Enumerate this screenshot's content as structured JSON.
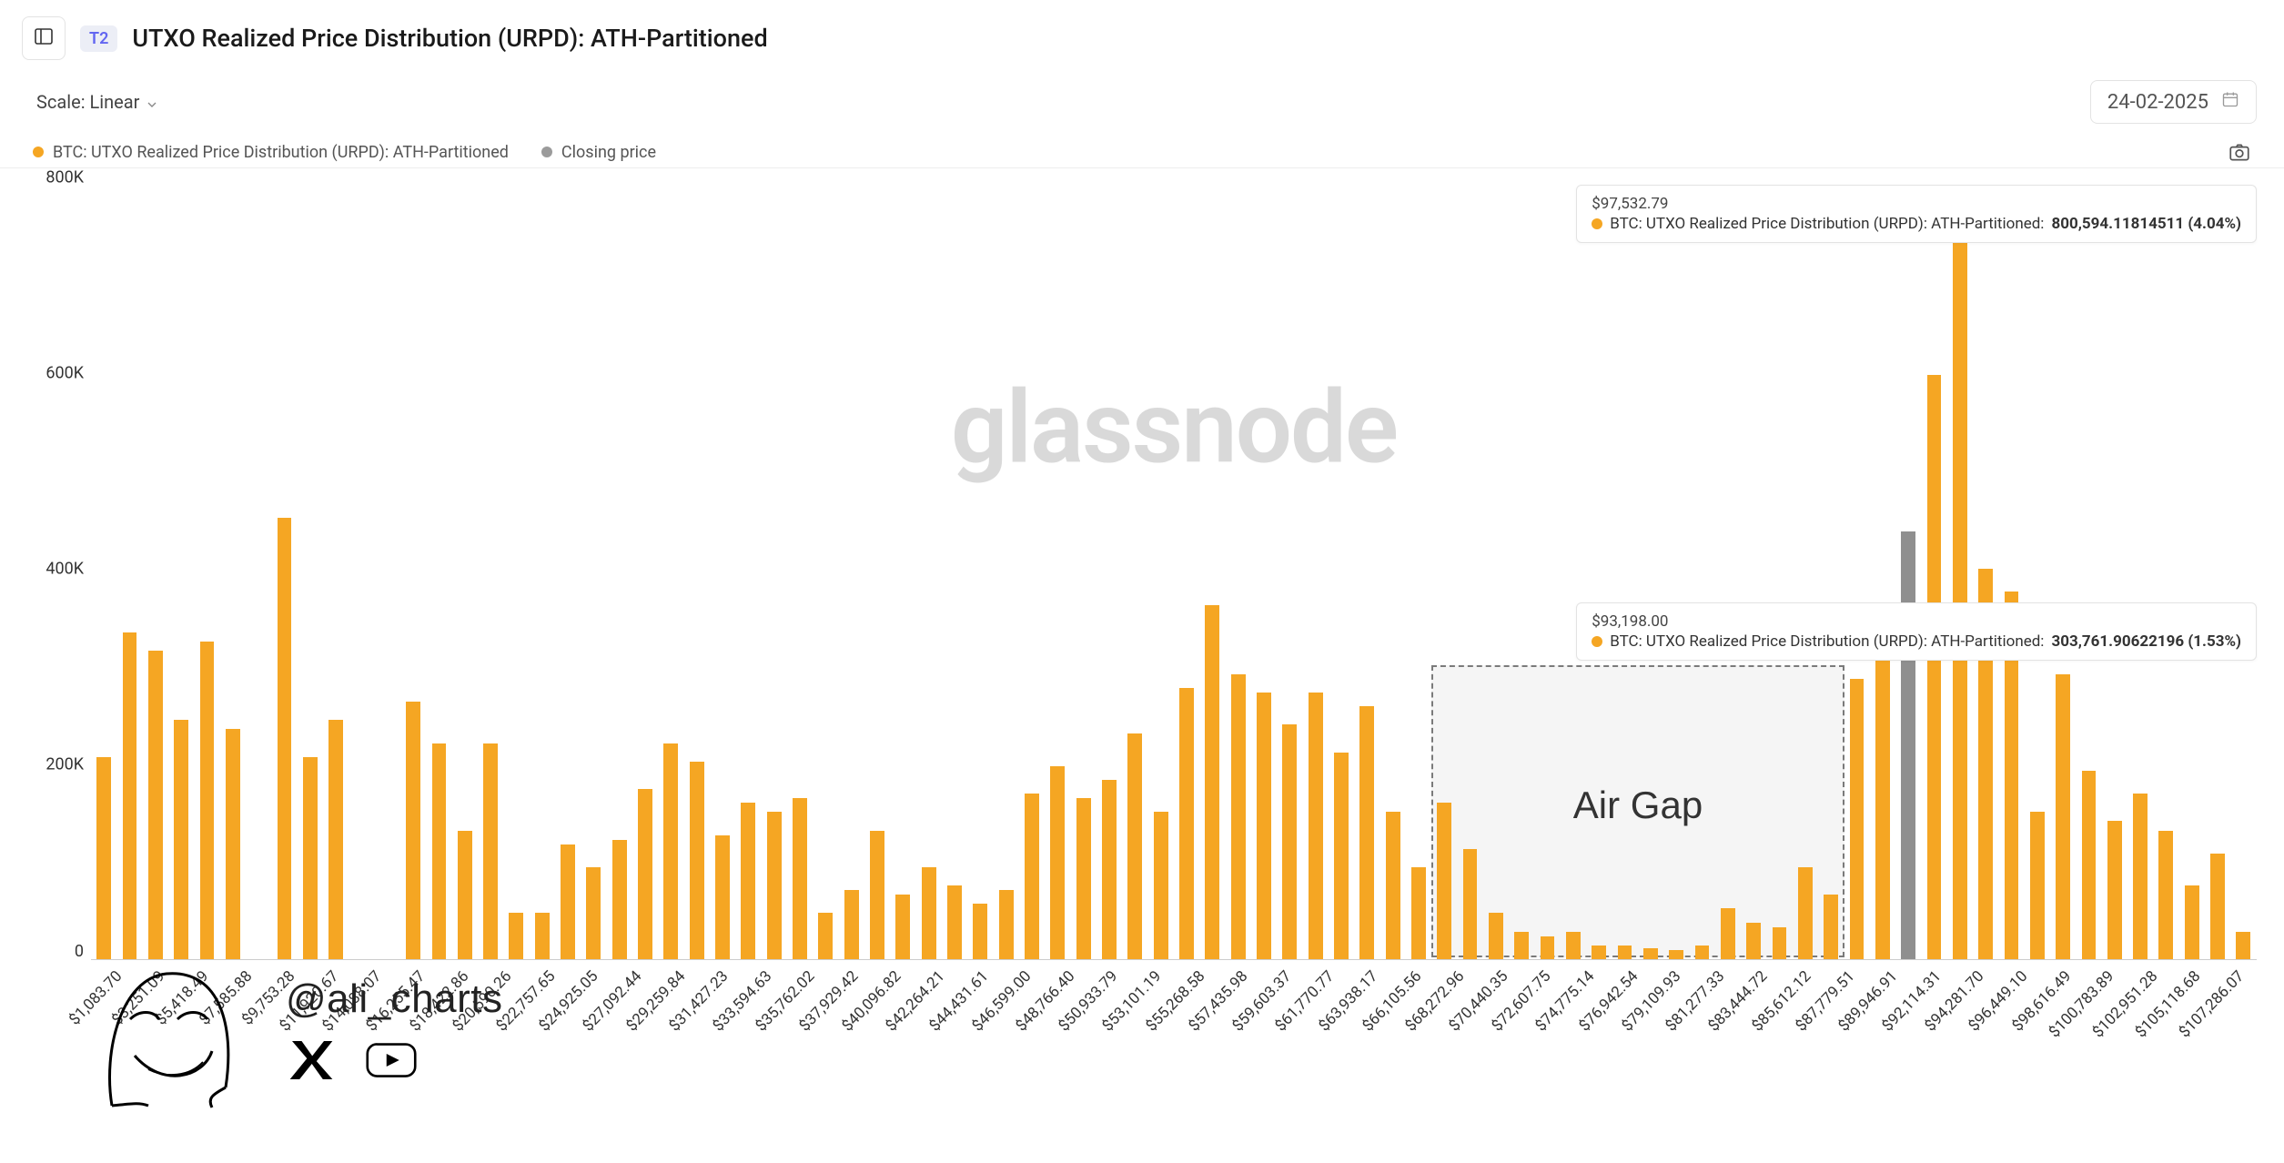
{
  "header": {
    "tier_badge": "T2",
    "title": "UTXO Realized Price Distribution (URPD): ATH-Partitioned"
  },
  "controls": {
    "scale_label": "Scale: Linear",
    "date_value": "24-02-2025"
  },
  "legend": {
    "series1": "BTC: UTXO Realized Price Distribution (URPD): ATH-Partitioned",
    "series2": "Closing price"
  },
  "tooltip_top": {
    "price": "$97,532.79",
    "prefix": "BTC: UTXO Realized Price Distribution (URPD): ATH-Partitioned: ",
    "value": "800,594.11814511 (4.04%)"
  },
  "tooltip_mid": {
    "price": "$93,198.00",
    "prefix": "BTC: UTXO Realized Price Distribution (URPD): ATH-Partitioned: ",
    "value": "303,761.90622196 (1.53%)"
  },
  "airgap_label": "Air Gap",
  "watermark": "glassnode",
  "attribution": {
    "handle": "@ali_charts"
  },
  "y_ticks": [
    "0",
    "200K",
    "400K",
    "600K",
    "800K"
  ],
  "chart_data": {
    "type": "bar",
    "title": "UTXO Realized Price Distribution (URPD): ATH-Partitioned",
    "xlabel": "",
    "ylabel": "",
    "ylim": [
      0,
      850000
    ],
    "y_ticks": [
      0,
      200000,
      400000,
      600000,
      800000
    ],
    "closing_price_bar_index": 44,
    "air_gap_range": [
      32,
      42
    ],
    "categories": [
      "$1,083.70",
      "$3,251.09",
      "$5,418.49",
      "$7,585.88",
      "$9,753.28",
      "$11,920.67",
      "$14,088.07",
      "$16,255.47",
      "$18,422.86",
      "$20,590.26",
      "$22,757.65",
      "$24,925.05",
      "$27,092.44",
      "$29,259.84",
      "$31,427.23",
      "$33,594.63",
      "$35,762.02",
      "$37,929.42",
      "$40,096.82",
      "$42,264.21",
      "$44,431.61",
      "$46,599.00",
      "$48,766.40",
      "$50,933.79",
      "$53,101.19",
      "$55,268.58",
      "$57,435.98",
      "$59,603.37",
      "$61,770.77",
      "$63,938.17",
      "$66,105.56",
      "$68,272.96",
      "$70,440.35",
      "$72,607.75",
      "$74,775.14",
      "$76,942.54",
      "$79,109.93",
      "$81,277.33",
      "$83,444.72",
      "$85,612.12",
      "$87,779.51",
      "$89,946.91",
      "$92,114.31",
      "$94,281.70",
      "$96,449.10",
      "$98,616.49",
      "$100,783.89",
      "$102,951.28",
      "$105,118.68",
      "$107,286.07"
    ],
    "series": [
      {
        "name": "BTC: UTXO Realized Price Distribution (URPD): ATH-Partitioned",
        "color": "#f5a623",
        "values": [
          220000,
          355000,
          335000,
          260000,
          345000,
          250000,
          0,
          480000,
          220000,
          260000,
          0,
          0,
          280000,
          235000,
          140000,
          235000,
          50000,
          50000,
          125000,
          100000,
          130000,
          185000,
          235000,
          215000,
          135000,
          170000,
          160000,
          175000,
          50000,
          75000,
          140000,
          70000,
          100000,
          80000,
          60000,
          75000,
          180000,
          210000,
          175000,
          195000,
          245000,
          160000,
          295000,
          385000,
          310000,
          290000,
          255000,
          290000,
          225000,
          275000,
          160000,
          100000,
          170000,
          120000,
          50000,
          30000,
          25000,
          30000,
          15000,
          15000,
          12000,
          10000,
          15000,
          55000,
          40000,
          35000,
          100000,
          70000,
          305000,
          330000,
          null,
          635000,
          800000,
          425000,
          400000,
          160000,
          310000,
          205000,
          150000,
          180000,
          140000,
          80000,
          115000,
          30000
        ]
      },
      {
        "name": "Closing price",
        "color": "#8f8f8f",
        "values_sparse": {
          "70": 465000
        }
      }
    ],
    "tooltips": [
      {
        "price": 97532.79,
        "value": 800594.11814511,
        "percent": 4.04
      },
      {
        "price": 93198.0,
        "value": 303761.90622196,
        "percent": 1.53
      }
    ]
  }
}
